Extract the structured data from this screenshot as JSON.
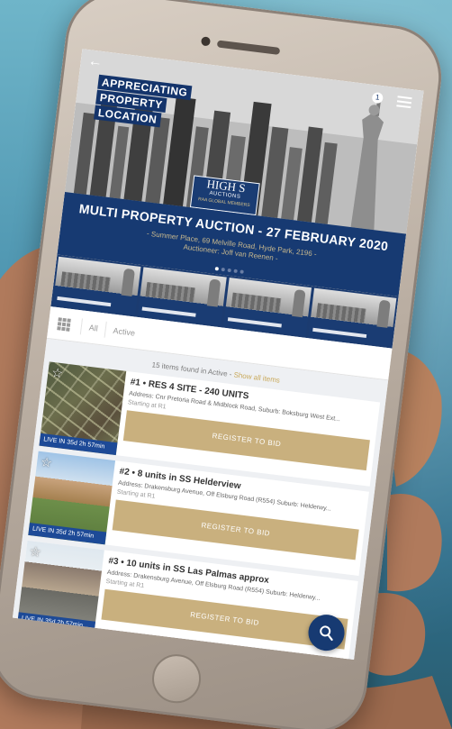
{
  "header": {
    "back_icon": "back-arrow-icon",
    "notification_count": "1",
    "menu_icon": "hamburger-menu-icon"
  },
  "banner": {
    "tagline_lines": [
      "APPRECIATING",
      "PROPERTY",
      "LOCATION"
    ],
    "logo_text": "HIGH S",
    "logo_sub": "AUCTIONS",
    "logo_partner": "RAA GLOBAL MEMBERS",
    "auction_title": "MULTI PROPERTY AUCTION - 27 FEBRUARY 2020",
    "auction_address": "- Summer Place, 69 Melville Road, Hyde Park, 2196 -",
    "auctioneer": "Auctioneer: Joff van Reenen -"
  },
  "carousel": {
    "slides": 5,
    "active_slide": 1
  },
  "filter": {
    "grid_icon": "grid-view-icon",
    "chips": [
      "All",
      "Active"
    ]
  },
  "list": {
    "found_text": "15 items found in Active -",
    "found_link": "Show all items",
    "register_label": "REGISTER TO BID",
    "items": [
      {
        "title": "#1 • RES 4 SITE - 240 UNITS",
        "address": "Address: Cnr Pretoria Road & Midblock Road, Suburb: Boksburg West Ext...",
        "starting": "Starting at R1",
        "live": "LIVE IN 35d 2h 57min"
      },
      {
        "title": "#2 • 8 units in SS Helderview",
        "address": "Address: Drakensburg Avenue, Off Elsburg Road (R554) Suburb: Helderwy...",
        "starting": "Starting at R1",
        "live": "LIVE IN 35d 2h 57min"
      },
      {
        "title": "#3 • 10 units in SS Las Palmas approx",
        "address": "Address: Drakensburg Avenue, Off Elsburg Road (R554) Suburb: Helderwy...",
        "starting": "Starting at R1",
        "live": "LIVE IN 35d 2h 57min"
      }
    ]
  },
  "fab": {
    "icon": "search-icon"
  },
  "colors": {
    "navy": "#173a72",
    "gold": "#c9b07e",
    "badge_blue": "#1d4a97"
  }
}
